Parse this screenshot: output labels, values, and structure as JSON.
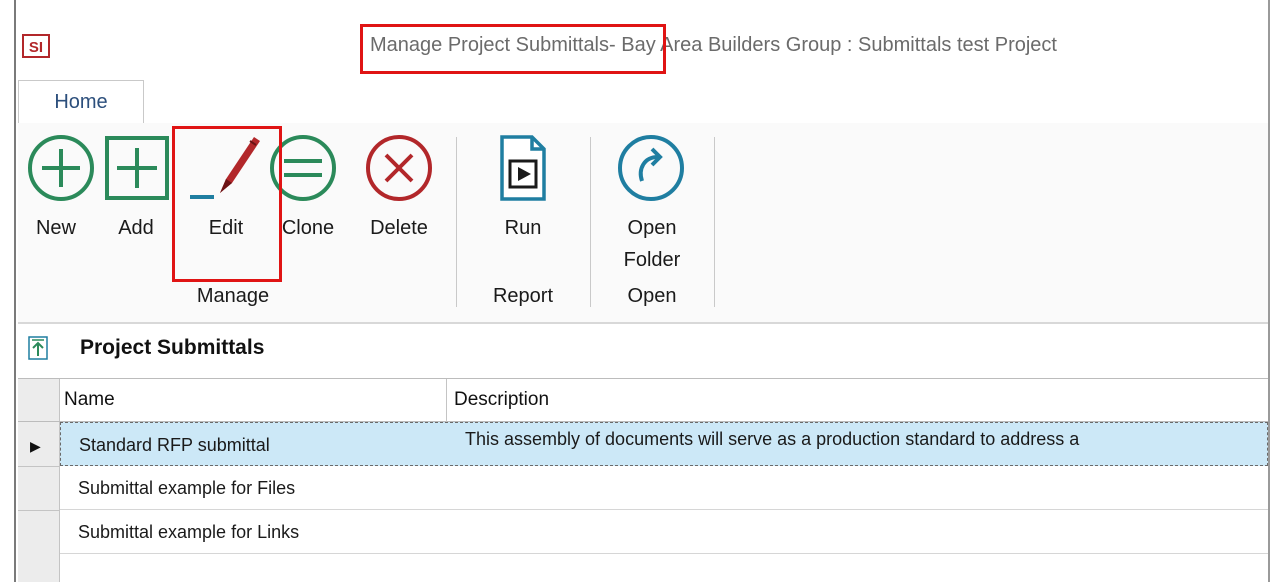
{
  "window": {
    "title_highlight": "Manage Project Submittals",
    "title_rest": "- Bay Area Builders Group : Submittals test Project",
    "logo_text": "SI"
  },
  "tabs": [
    {
      "label": "Home"
    }
  ],
  "ribbon": {
    "groups": [
      {
        "label": "Manage",
        "buttons": [
          {
            "label": "New",
            "icon": "plus-circle-icon"
          },
          {
            "label": "Add",
            "icon": "plus-square-icon"
          },
          {
            "label": "Edit",
            "icon": "pen-icon"
          },
          {
            "label": "Clone",
            "icon": "equals-circle-icon"
          },
          {
            "label": "Delete",
            "icon": "x-circle-icon"
          }
        ]
      },
      {
        "label": "Report",
        "buttons": [
          {
            "label": "Run",
            "icon": "run-report-icon"
          }
        ]
      },
      {
        "label": "Open",
        "buttons": [
          {
            "label": "Open",
            "label2": "Folder",
            "icon": "open-folder-arrow-icon"
          }
        ]
      }
    ]
  },
  "section": {
    "title": "Project Submittals",
    "icon": "upload-arrow-icon"
  },
  "grid": {
    "columns": [
      "Name",
      "Description"
    ],
    "rows": [
      {
        "name": "Standard RFP submittal",
        "description": "This assembly of documents will serve as a production standard to address a",
        "selected": true
      },
      {
        "name": "Submittal example for Files",
        "description": "",
        "selected": false
      },
      {
        "name": "Submittal example for Links",
        "description": "",
        "selected": false
      }
    ]
  },
  "colors": {
    "green": "#2b8a5a",
    "teal": "#1f7ea1",
    "red": "#b2272a",
    "selection": "#cce8f7",
    "highlight_box": "#e01414"
  }
}
